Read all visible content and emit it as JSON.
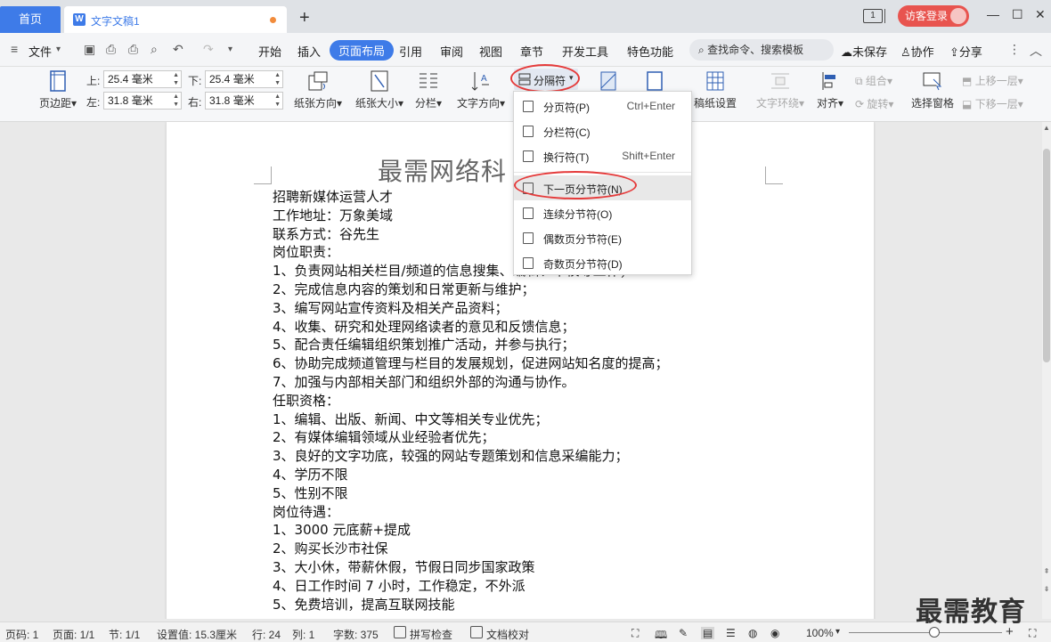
{
  "titlebar": {
    "home_tab": "首页",
    "doc_tab": "文字文稿1",
    "new_tab": "+",
    "window_count": "1",
    "login": "访客登录"
  },
  "menu": {
    "file": "文件",
    "tabs": [
      "开始",
      "插入",
      "页面布局",
      "引用",
      "审阅",
      "视图",
      "章节",
      "开发工具",
      "特色功能"
    ],
    "active_tab": "页面布局",
    "search": "查找命令、搜索模板",
    "unsaved": "未保存",
    "collab": "协作",
    "share": "分享"
  },
  "ribbon": {
    "margins": "页边距",
    "margin_top_label": "上:",
    "margin_top": "25.4 毫米",
    "margin_bottom_label": "下:",
    "margin_bottom": "25.4 毫米",
    "margin_left_label": "左:",
    "margin_left": "31.8 毫米",
    "margin_right_label": "右:",
    "margin_right": "31.8 毫米",
    "orientation": "纸张方向",
    "size": "纸张大小",
    "columns": "分栏",
    "text_direction": "文字方向",
    "separator": "分隔符",
    "draft_settings": "稿纸设置",
    "text_wrap": "文字环绕",
    "align": "对齐",
    "group": "组合",
    "rotate": "旋转",
    "select_pane": "选择窗格",
    "bring_forward": "上移一层",
    "send_backward": "下移一层"
  },
  "dropdown": {
    "items": [
      {
        "label": "分页符(P)",
        "shortcut": "Ctrl+Enter"
      },
      {
        "label": "分栏符(C)",
        "shortcut": ""
      },
      {
        "label": "换行符(T)",
        "shortcut": "Shift+Enter"
      },
      {
        "label": "下一页分节符(N)",
        "shortcut": ""
      },
      {
        "label": "连续分节符(O)",
        "shortcut": ""
      },
      {
        "label": "偶数页分节符(E)",
        "shortcut": ""
      },
      {
        "label": "奇数页分节符(D)",
        "shortcut": ""
      }
    ],
    "highlighted": "下一页分节符(N)"
  },
  "document": {
    "title": "最需网络科",
    "lines": [
      "招聘新媒体运营人才",
      "工作地址：万象美域",
      "联系方式：谷先生",
      "岗位职责：",
      "1、负责网站相关栏目/频道的信息搜集、编辑、审校等工作；",
      "2、完成信息内容的策划和日常更新与维护；",
      "3、编写网站宣传资料及相关产品资料；",
      "4、收集、研究和处理网络读者的意见和反馈信息；",
      "5、配合责任编辑组织策划推广活动，并参与执行；",
      "6、协助完成频道管理与栏目的发展规划，促进网站知名度的提高；",
      "7、加强与内部相关部门和组织外部的沟通与协作。",
      "任职资格：",
      "1、编辑、出版、新闻、中文等相关专业优先；",
      "2、有媒体编辑领域从业经验者优先；",
      "3、良好的文字功底，较强的网站专题策划和信息采编能力；",
      "4、学历不限",
      "5、性别不限",
      "岗位待遇：",
      "1、3000 元底薪+提成",
      "2、购买长沙市社保",
      "3、大小休，带薪休假，节假日同步国家政策",
      "4、日工作时间 7 小时，工作稳定，不外派",
      "5、免费培训，提高互联网技能"
    ]
  },
  "status": {
    "page_num": "页码: 1",
    "pages": "页面: 1/1",
    "section": "节: 1/1",
    "setting": "设置值: 15.3厘米",
    "row": "行: 24",
    "col": "列: 1",
    "words": "字数: 375",
    "spellcheck": "拼写检查",
    "proofread": "文档校对",
    "zoom": "100%"
  },
  "watermark": "最需教育",
  "colors": {
    "accent": "#3e7be8",
    "highlight_ring": "#e53b3b",
    "login": "#e8544f"
  }
}
